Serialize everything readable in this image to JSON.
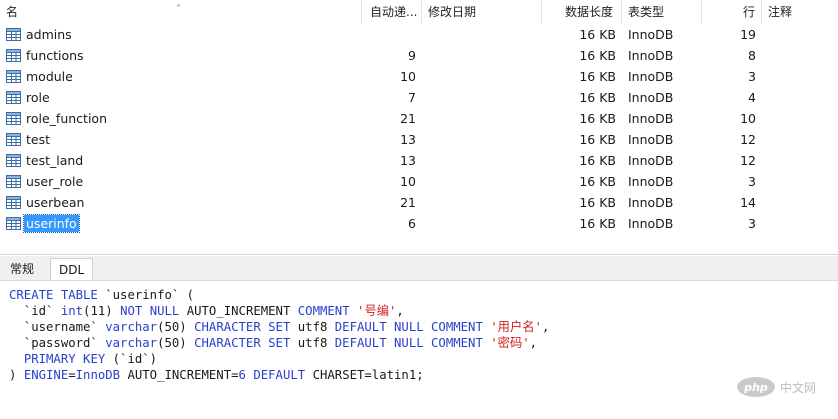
{
  "columns": {
    "name": "名",
    "auto_increment": "自动递...",
    "modified_date": "修改日期",
    "data_length": "数据长度",
    "table_type": "表类型",
    "rows": "行",
    "comment": "注释"
  },
  "tables": [
    {
      "name": "admins",
      "auto_increment": "",
      "data_length": "16 KB",
      "type": "InnoDB",
      "rows": "19"
    },
    {
      "name": "functions",
      "auto_increment": "9",
      "data_length": "16 KB",
      "type": "InnoDB",
      "rows": "8"
    },
    {
      "name": "module",
      "auto_increment": "10",
      "data_length": "16 KB",
      "type": "InnoDB",
      "rows": "3"
    },
    {
      "name": "role",
      "auto_increment": "7",
      "data_length": "16 KB",
      "type": "InnoDB",
      "rows": "4"
    },
    {
      "name": "role_function",
      "auto_increment": "21",
      "data_length": "16 KB",
      "type": "InnoDB",
      "rows": "10"
    },
    {
      "name": "test",
      "auto_increment": "13",
      "data_length": "16 KB",
      "type": "InnoDB",
      "rows": "12"
    },
    {
      "name": "test_land",
      "auto_increment": "13",
      "data_length": "16 KB",
      "type": "InnoDB",
      "rows": "12"
    },
    {
      "name": "user_role",
      "auto_increment": "10",
      "data_length": "16 KB",
      "type": "InnoDB",
      "rows": "3"
    },
    {
      "name": "userbean",
      "auto_increment": "21",
      "data_length": "16 KB",
      "type": "InnoDB",
      "rows": "14"
    },
    {
      "name": "userinfo",
      "auto_increment": "6",
      "data_length": "16 KB",
      "type": "InnoDB",
      "rows": "3",
      "selected": true
    }
  ],
  "tabs": {
    "general": "常规",
    "ddl": "DDL",
    "active": "ddl"
  },
  "ddl": [
    [
      [
        "kw",
        "CREATE TABLE"
      ],
      [
        "t",
        " `userinfo` ("
      ]
    ],
    [
      [
        "t",
        "  `id` "
      ],
      [
        "kw",
        "int"
      ],
      [
        "t",
        "(11) "
      ],
      [
        "kw",
        "NOT NULL"
      ],
      [
        "t",
        " AUTO_INCREMENT "
      ],
      [
        "kw",
        "COMMENT"
      ],
      [
        "t",
        " "
      ],
      [
        "str",
        "'号编'"
      ],
      [
        "t",
        ","
      ]
    ],
    [
      [
        "t",
        "  `username` "
      ],
      [
        "kw",
        "varchar"
      ],
      [
        "t",
        "(50) "
      ],
      [
        "kw",
        "CHARACTER SET"
      ],
      [
        "t",
        " utf8 "
      ],
      [
        "kw",
        "DEFAULT NULL COMMENT"
      ],
      [
        "t",
        " "
      ],
      [
        "str",
        "'用户名'"
      ],
      [
        "t",
        ","
      ]
    ],
    [
      [
        "t",
        "  `password` "
      ],
      [
        "kw",
        "varchar"
      ],
      [
        "t",
        "(50) "
      ],
      [
        "kw",
        "CHARACTER SET"
      ],
      [
        "t",
        " utf8 "
      ],
      [
        "kw",
        "DEFAULT NULL COMMENT"
      ],
      [
        "t",
        " "
      ],
      [
        "str",
        "'密码'"
      ],
      [
        "t",
        ","
      ]
    ],
    [
      [
        "t",
        "  "
      ],
      [
        "kw",
        "PRIMARY KEY"
      ],
      [
        "t",
        " (`id`)"
      ]
    ],
    [
      [
        "t",
        ") "
      ],
      [
        "kw",
        "ENGINE"
      ],
      [
        "t",
        "="
      ],
      [
        "kw",
        "InnoDB"
      ],
      [
        "t",
        " AUTO_INCREMENT="
      ],
      [
        "kw",
        "6"
      ],
      [
        "t",
        " "
      ],
      [
        "kw",
        "DEFAULT"
      ],
      [
        "t",
        " CHARSET=latin1;"
      ]
    ]
  ],
  "watermark": {
    "logo_text": "php",
    "site_text": "中文网"
  },
  "colors": {
    "selection": "#3399ff",
    "keyword": "#2b3fcf",
    "string": "#d11f1f",
    "table_icon": "#3a6ea5"
  },
  "icons": {
    "table": "table-grid-icon",
    "sort": "sort-caret-up-icon"
  }
}
